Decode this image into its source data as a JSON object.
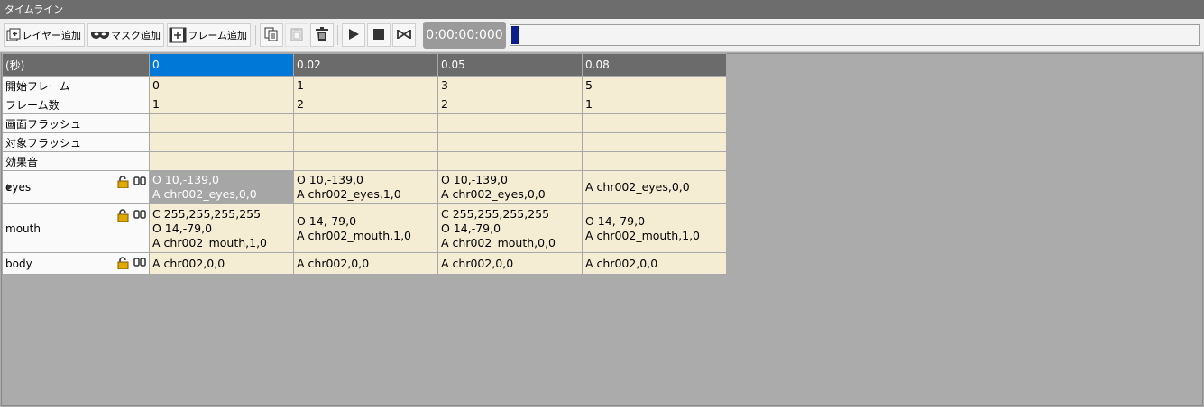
{
  "window": {
    "title": "タイムライン"
  },
  "toolbar": {
    "add_layer_label": "レイヤー追加",
    "add_mask_label": "マスク追加",
    "add_frame_label": "フレーム追加",
    "timecode": "0:00:00:000",
    "seek_position": 0.0
  },
  "grid": {
    "corner_label": "(秒)",
    "columns": [
      "0",
      "0.02",
      "0.05",
      "0.08"
    ],
    "selected_column": 0,
    "rows": {
      "start_frame": {
        "label": "開始フレーム",
        "values": [
          "0",
          "1",
          "3",
          "5"
        ]
      },
      "frame_count": {
        "label": "フレーム数",
        "values": [
          "1",
          "2",
          "2",
          "1"
        ]
      },
      "screen_flash": {
        "label": "画面フラッシュ"
      },
      "target_flash": {
        "label": "対象フラッシュ"
      },
      "sound_effect": {
        "label": "効果音"
      }
    },
    "layers": {
      "eyes": {
        "name": "eyes",
        "cells": [
          [
            "O 10,-139,0",
            "A chr002_eyes,0,0"
          ],
          [
            "O 10,-139,0",
            "A chr002_eyes,1,0"
          ],
          [
            "O 10,-139,0",
            "A chr002_eyes,0,0"
          ],
          [
            "A chr002_eyes,0,0"
          ]
        ]
      },
      "mouth": {
        "name": "mouth",
        "cells": [
          [
            "C 255,255,255,255",
            "O 14,-79,0",
            "A chr002_mouth,1,0"
          ],
          [
            "O 14,-79,0",
            "A chr002_mouth,1,0"
          ],
          [
            "C 255,255,255,255",
            "O 14,-79,0",
            "A chr002_mouth,0,0"
          ],
          [
            "O 14,-79,0",
            "A chr002_mouth,1,0"
          ]
        ]
      },
      "body": {
        "name": "body",
        "cells": [
          [
            "A chr002,0,0"
          ],
          [
            "A chr002,0,0"
          ],
          [
            "A chr002,0,0"
          ],
          [
            "A chr002,0,0"
          ]
        ]
      }
    }
  },
  "colors": {
    "cell_bg": "#f5edd3",
    "header_bg": "#6b6b6b",
    "selected_header": "#0078d7",
    "lock_icon": "#e0a800"
  },
  "icons": [
    "add-layer-icon",
    "add-mask-icon",
    "add-frame-icon",
    "copy-icon",
    "paste-icon",
    "delete-icon",
    "play-icon",
    "stop-icon",
    "loop-icon",
    "lock-icon",
    "link-icon"
  ]
}
